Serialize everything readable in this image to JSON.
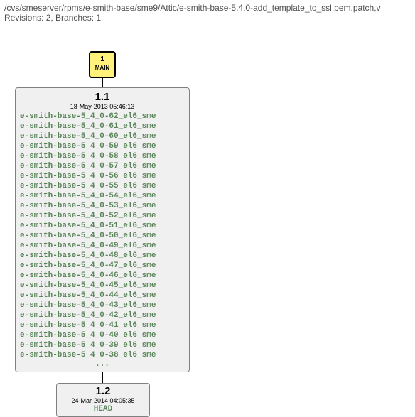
{
  "header": {
    "path": "/cvs/smeserver/rpms/e-smith-base/sme9/Attic/e-smith-base-5.4.0-add_template_to_ssl.pem.patch,v",
    "meta": "Revisions: 2, Branches: 1"
  },
  "main_node": {
    "num": "1",
    "label": "MAIN"
  },
  "rev1": {
    "version": "1.1",
    "date": "18-May-2013 05:46:13",
    "tags": [
      "e-smith-base-5_4_0-62_el6_sme",
      "e-smith-base-5_4_0-61_el6_sme",
      "e-smith-base-5_4_0-60_el6_sme",
      "e-smith-base-5_4_0-59_el6_sme",
      "e-smith-base-5_4_0-58_el6_sme",
      "e-smith-base-5_4_0-57_el6_sme",
      "e-smith-base-5_4_0-56_el6_sme",
      "e-smith-base-5_4_0-55_el6_sme",
      "e-smith-base-5_4_0-54_el6_sme",
      "e-smith-base-5_4_0-53_el6_sme",
      "e-smith-base-5_4_0-52_el6_sme",
      "e-smith-base-5_4_0-51_el6_sme",
      "e-smith-base-5_4_0-50_el6_sme",
      "e-smith-base-5_4_0-49_el6_sme",
      "e-smith-base-5_4_0-48_el6_sme",
      "e-smith-base-5_4_0-47_el6_sme",
      "e-smith-base-5_4_0-46_el6_sme",
      "e-smith-base-5_4_0-45_el6_sme",
      "e-smith-base-5_4_0-44_el6_sme",
      "e-smith-base-5_4_0-43_el6_sme",
      "e-smith-base-5_4_0-42_el6_sme",
      "e-smith-base-5_4_0-41_el6_sme",
      "e-smith-base-5_4_0-40_el6_sme",
      "e-smith-base-5_4_0-39_el6_sme",
      "e-smith-base-5_4_0-38_el6_sme"
    ],
    "ellipsis": "..."
  },
  "rev2": {
    "version": "1.2",
    "date": "24-Mar-2014 04:05:35",
    "head": "HEAD"
  }
}
